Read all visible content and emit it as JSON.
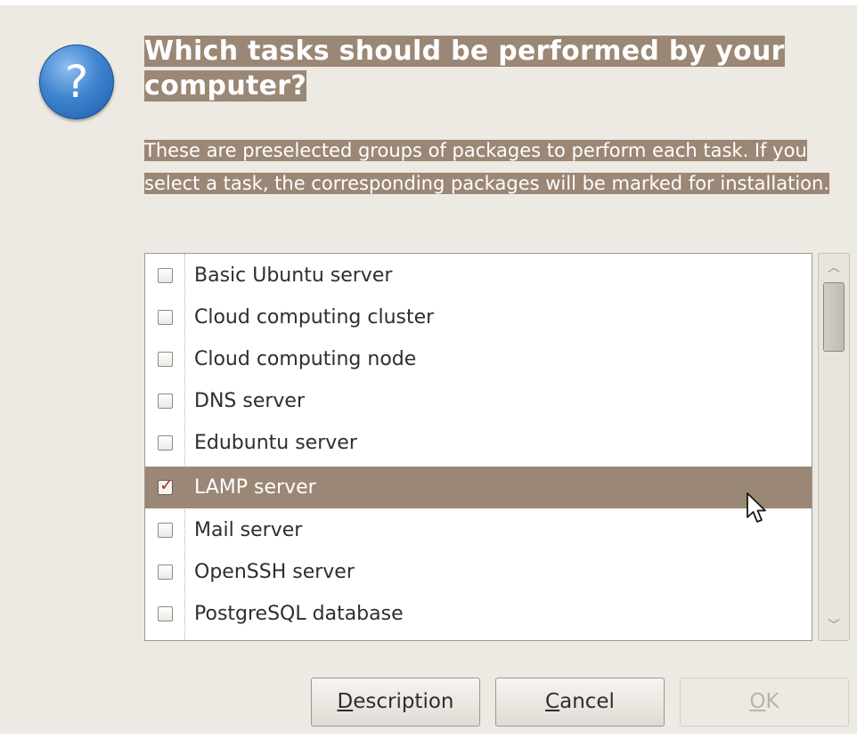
{
  "dialog": {
    "title": "Which tasks should be performed by your computer?",
    "description": "These are preselected groups of packages to perform each task. If you select a task, the corresponding packages will be marked for installation.",
    "icon": "question-icon"
  },
  "tasks": [
    {
      "label": "Basic Ubuntu server",
      "checked": false,
      "selected": false
    },
    {
      "label": "Cloud computing cluster",
      "checked": false,
      "selected": false
    },
    {
      "label": "Cloud computing node",
      "checked": false,
      "selected": false
    },
    {
      "label": "DNS server",
      "checked": false,
      "selected": false
    },
    {
      "label": "Edubuntu server",
      "checked": false,
      "selected": false
    },
    {
      "label": "LAMP server",
      "checked": true,
      "selected": true
    },
    {
      "label": "Mail server",
      "checked": false,
      "selected": false
    },
    {
      "label": "OpenSSH server",
      "checked": false,
      "selected": false
    },
    {
      "label": "PostgreSQL database",
      "checked": false,
      "selected": false
    }
  ],
  "buttons": {
    "description": {
      "mnemonic": "D",
      "rest": "escription",
      "enabled": true
    },
    "cancel": {
      "mnemonic": "C",
      "rest": "ancel",
      "enabled": true
    },
    "ok": {
      "mnemonic": "O",
      "rest": "K",
      "enabled": false
    }
  },
  "colors": {
    "selection": "#9b8776",
    "dialog_background": "#ede9e3",
    "checkmark": "#a63a20"
  }
}
